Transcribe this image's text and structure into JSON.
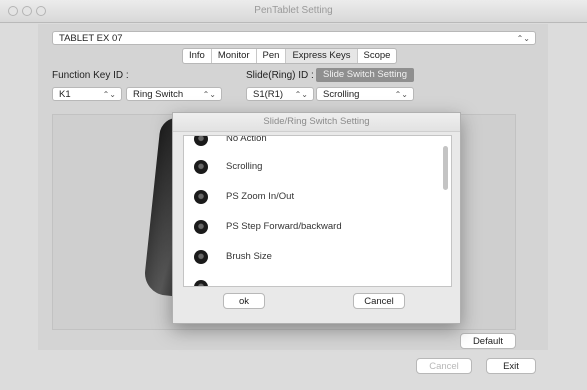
{
  "window": {
    "title": "PenTablet Setting"
  },
  "device": {
    "value": "TABLET EX 07"
  },
  "tabs": [
    {
      "label": "Info"
    },
    {
      "label": "Monitor"
    },
    {
      "label": "Pen"
    },
    {
      "label": "Express Keys"
    },
    {
      "label": "Scope"
    }
  ],
  "function_key": {
    "label": "Function Key ID :",
    "key_value": "K1",
    "type_value": "Ring Switch"
  },
  "slide_ring": {
    "label": "Slide(Ring) ID :",
    "setting_button": "Slide Switch Setting",
    "id_value": "S1(R1)",
    "action_value": "Scrolling"
  },
  "buttons": {
    "default": "Default",
    "cancel": "Cancel",
    "exit": "Exit"
  },
  "dialog": {
    "title": "Slide/Ring Switch Setting",
    "items": [
      {
        "label": "No Action"
      },
      {
        "label": "Scrolling"
      },
      {
        "label": "PS Zoom In/Out"
      },
      {
        "label": "PS Step Forward/backward"
      },
      {
        "label": "Brush Size"
      },
      {
        "label": ""
      }
    ],
    "ok": "ok",
    "cancel": "Cancel"
  }
}
